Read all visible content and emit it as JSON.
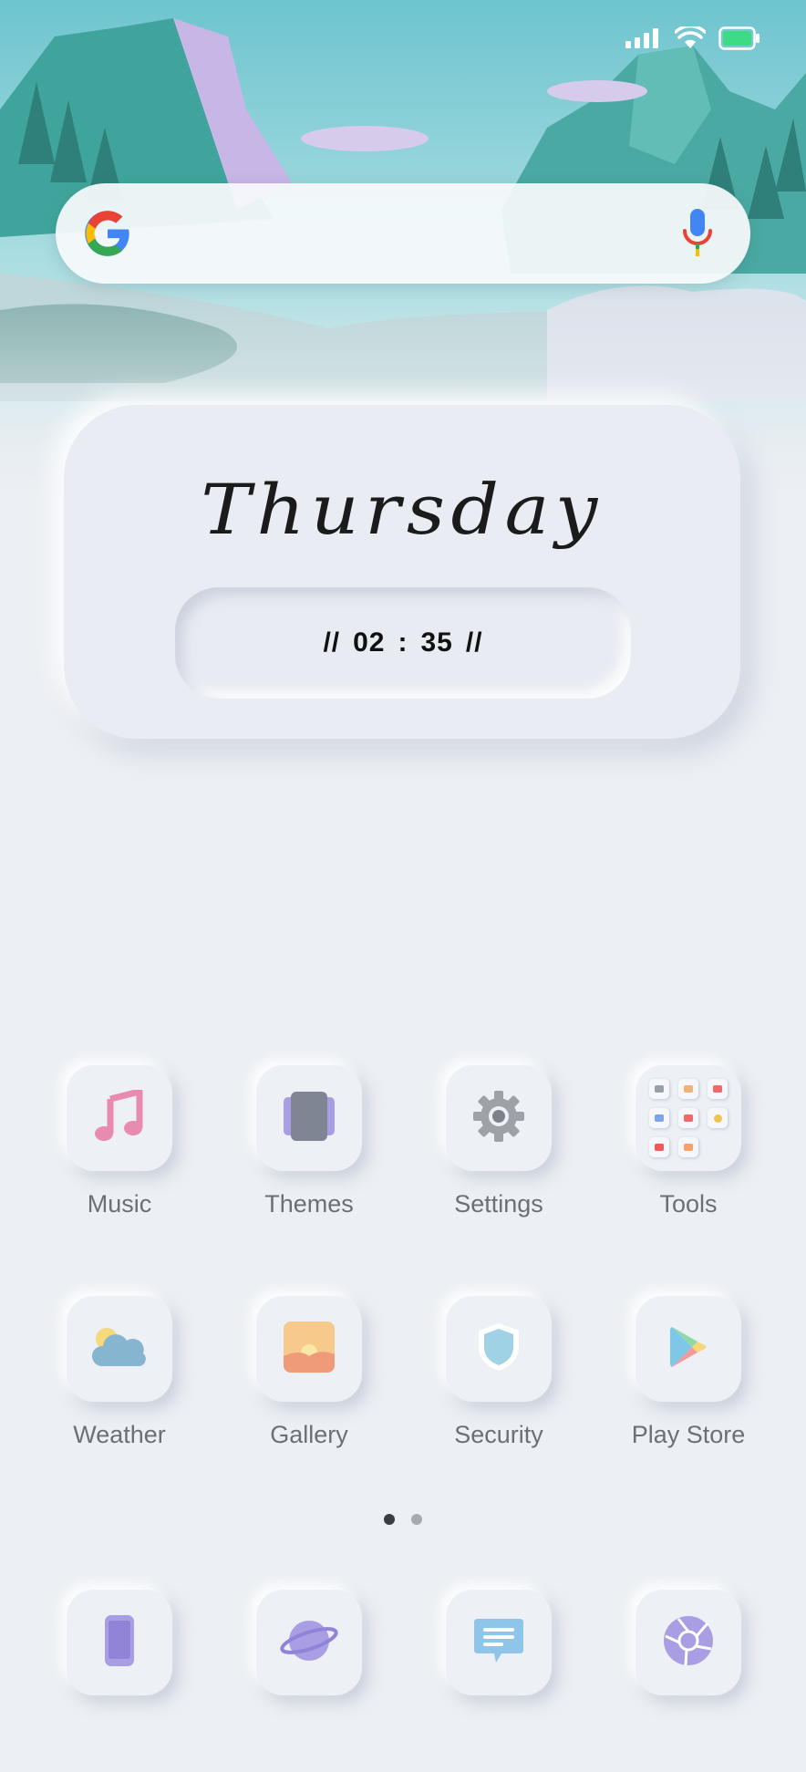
{
  "status_bar": {
    "icons": [
      "signal-icon",
      "wifi-icon",
      "battery-icon"
    ],
    "battery_color": "#3ddc84"
  },
  "search": {
    "icons": [
      "google-logo",
      "mic-icon"
    ]
  },
  "clock_widget": {
    "day": "Thursday",
    "time_prefix": "//",
    "hour": "02",
    "separator": ":",
    "minute": "35",
    "time_suffix": "//"
  },
  "apps": [
    {
      "label": "Music",
      "icon": "music-note-icon",
      "color": "#e98ab0"
    },
    {
      "label": "Themes",
      "icon": "themes-icon",
      "color": "#7f8593"
    },
    {
      "label": "Settings",
      "icon": "gear-icon",
      "color": "#9ea1a8"
    },
    {
      "label": "Tools",
      "icon": "tools-folder-icon",
      "color": "#f0f2f6"
    },
    {
      "label": "Weather",
      "icon": "weather-cloud-icon",
      "color": "#86b6cf"
    },
    {
      "label": "Gallery",
      "icon": "gallery-icon",
      "color": "#f4b26f"
    },
    {
      "label": "Security",
      "icon": "shield-icon",
      "color": "#9fd2e4"
    },
    {
      "label": "Play Store",
      "icon": "play-store-icon",
      "color": "#7fc7e9"
    }
  ],
  "page_indicator": {
    "count": 2,
    "active": 1,
    "active_color": "#3b3d42",
    "inactive_color": "#a7aab0"
  },
  "dock": [
    {
      "icon": "phone-icon",
      "color": "#a99ee3"
    },
    {
      "icon": "browser-planet-icon",
      "color": "#a99ee3"
    },
    {
      "icon": "messages-icon",
      "color": "#8fc5e8"
    },
    {
      "icon": "camera-shutter-icon",
      "color": "#a99ee3"
    }
  ]
}
